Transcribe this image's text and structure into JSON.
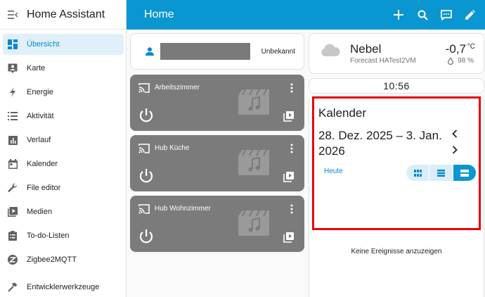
{
  "app": {
    "title": "Home Assistant"
  },
  "sidebar": {
    "items": [
      {
        "label": "Übersicht",
        "icon": "dashboard-icon",
        "active": true
      },
      {
        "label": "Karte",
        "icon": "map-icon"
      },
      {
        "label": "Energie",
        "icon": "lightning-icon"
      },
      {
        "label": "Aktivität",
        "icon": "list-icon"
      },
      {
        "label": "Verlauf",
        "icon": "chart-icon"
      },
      {
        "label": "Kalender",
        "icon": "calendar-icon"
      },
      {
        "label": "File editor",
        "icon": "wrench-icon"
      },
      {
        "label": "Medien",
        "icon": "media-icon"
      },
      {
        "label": "To-do-Listen",
        "icon": "clipboard-icon"
      },
      {
        "label": "Zigbee2MQTT",
        "icon": "zigbee-icon"
      },
      {
        "label": "Entwicklerwerkzeuge",
        "icon": "hammer-icon"
      }
    ]
  },
  "topbar": {
    "title": "Home"
  },
  "person": {
    "state": "Unbekannt"
  },
  "media_players": [
    {
      "name": "Arbeitszimmer"
    },
    {
      "name": "Hub Küche"
    },
    {
      "name": "Hub Wohnzimmer"
    }
  ],
  "weather": {
    "condition": "Nebel",
    "source": "Forecast HATest2VM",
    "temperature": "-0,7",
    "unit": "°C",
    "humidity": "98 %"
  },
  "clock": {
    "time": "10:56"
  },
  "calendar": {
    "title": "Kalender",
    "range_line1": "28. Dez. 2025 – 3. Jan.",
    "range_line2": "2026",
    "today_label": "Heute",
    "empty_text": "Keine Ereignisse anzuzeigen"
  },
  "colors": {
    "accent": "#0a97d1",
    "highlight": "#e8000b",
    "media_card": "#7b7b7b"
  }
}
